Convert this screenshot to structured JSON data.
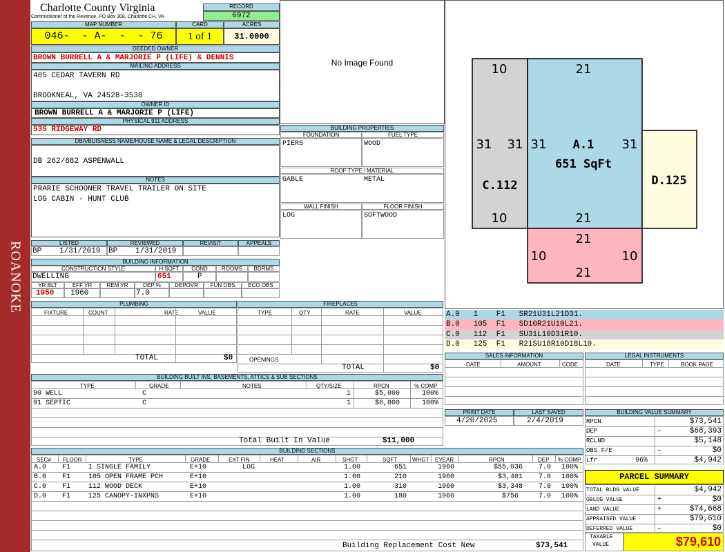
{
  "side_label": "ROANOKE",
  "header": {
    "county": "Charlotte County Virginia",
    "commissioner": "Commissioner of the Revenue, PO Box 308, Charlotte CH, VA",
    "record_label": "RECORD",
    "record": "6972",
    "map_number_label": "MAP NUMBER",
    "map_number": "046-  - A-  -  - 76",
    "card_label": "CARD",
    "card": "1 of 1",
    "acres_label": "ACRES",
    "acres": "31.0000"
  },
  "owner": {
    "deeded_owner_label": "DEEDED OWNER",
    "deeded_owner": "BROWN BURRELL A & MARJORIE P (LIFE) & DENNIS",
    "mailing_label": "MAILING ADDRESS",
    "mailing_line1": "405 CEDAR TAVERN RD",
    "mailing_line2": "BROOKNEAL, VA 24528-3538",
    "owner_id_label": "OWNER ID",
    "owner_id": "BROWN BURRELL A & MARJORIE P (LIFE)",
    "physical_label": "PHYSICAL 911 ADDRESS",
    "physical": "535 RIDGEWAY RD",
    "dba_label": "DBA/BUISNESS NAME/HOUSE NAME & LEGAL DESCRIPTION",
    "dba": "DB 262/682 ASPENWALL",
    "notes_label": "NOTES",
    "notes_line1": "PRARIE SCHOONER TRAVEL TRAILER ON SITE",
    "notes_line2": "LOG CABIN - HUNT CLUB"
  },
  "image_placeholder": "No Image Found",
  "building_properties": {
    "label": "BUILDING PROPERTIES",
    "foundation_label": "FOUNDATION",
    "foundation": "PIERS",
    "fuel_label": "FUEL TYPE",
    "fuel": "WOOD",
    "roof_label": "ROOF TYPE / MATERIAL",
    "roof_type": "GABLE",
    "roof_material": "METAL",
    "wall_label": "WALL FINISH",
    "wall": "LOG",
    "floor_label": "FLOOR FINISH",
    "floor": "SOFTWOOD"
  },
  "listing": {
    "listed_label": "LISTED",
    "listed_by": "BP",
    "listed_date": "1/31/2019",
    "reviewed_label": "REVIEWED",
    "reviewed_by": "BP",
    "reviewed_date": "1/31/2019",
    "revisit_label": "REVISIT",
    "appeals_label": "APPEALS"
  },
  "building_info": {
    "label": "BUILDING INFORMATION",
    "construction_label": "CONSTRUCTION STYLE",
    "construction": "DWELLING",
    "hsqft_label": "H SQFT",
    "hsqft": "651",
    "cond_label": "COND",
    "cond": "P",
    "rooms_label": "ROOMS",
    "bdrms_label": "BDRMS",
    "yrblt_label": "YR BLT",
    "yrblt": "1950",
    "effyr_label": "EFF YR",
    "effyr": "1960",
    "remyr_label": "REM YR",
    "dep_label": "DEP %",
    "dep": "7.0",
    "depovr_label": "DEPOVR",
    "funobs_label": "FUN OBS",
    "ecoobs_label": "ECO OBS"
  },
  "plumbing": {
    "label": "PLUMBING",
    "fixture_label": "FIXTURE",
    "count_label": "COUNT",
    "rate_label": "RATE",
    "value_label": "VALUE",
    "total_label": "TOTAL",
    "total": "$0"
  },
  "fireplaces": {
    "label": "FIREPLACES",
    "type_label": "TYPE",
    "qty_label": "QTY",
    "rate_label": "RATE",
    "value_label": "VALUE",
    "openings_label": "OPENINGS",
    "total_label": "TOTAL",
    "total": "$0"
  },
  "built_ins": {
    "label": "BUILDING BUILT INS, BASEMENTS, ATTICS & SUB SECTIONS",
    "cols": [
      "TYPE",
      "GRADE",
      "NOTES",
      "QTY/SIZE",
      "RPCN",
      "% COMP"
    ],
    "rows": [
      {
        "type": "90 WELL",
        "grade": "C",
        "qty": "1",
        "rpcn": "$5,000",
        "comp": "100%"
      },
      {
        "type": "91 SEPTIC",
        "grade": "C",
        "qty": "1",
        "rpcn": "$6,000",
        "comp": "100%"
      }
    ],
    "total_label": "Total Built In Value",
    "total": "$11,000"
  },
  "sections": {
    "label": "BUILDING SECTIONS",
    "cols": [
      "SEC#",
      "FLOOR",
      "TYPE",
      "GRADE",
      "EXT FIN",
      "HEAT",
      "AIR",
      "SHGT",
      "SQFT",
      "WHGT",
      "EYEAR",
      "RPCN",
      "DEP",
      "% COMP"
    ],
    "rows": [
      {
        "sec": "A.0",
        "floor": "F1",
        "type": "1 SINGLE FAMILY",
        "grade": "E+10",
        "ext": "LOG",
        "shgt": "1.00",
        "sqft": "651",
        "eyear": "1960",
        "rpcn": "$55,036",
        "dep": "7.0",
        "comp": "100%"
      },
      {
        "sec": "B.0",
        "floor": "F1",
        "type": "105 OPEN FRAME PCH",
        "grade": "E+10",
        "ext": "",
        "shgt": "1.00",
        "sqft": "210",
        "eyear": "1960",
        "rpcn": "$3,401",
        "dep": "7.0",
        "comp": "100%"
      },
      {
        "sec": "C.0",
        "floor": "F1",
        "type": "112 WOOD DECK",
        "grade": "E+10",
        "ext": "",
        "shgt": "1.00",
        "sqft": "310",
        "eyear": "1960",
        "rpcn": "$3,348",
        "dep": "7.0",
        "comp": "100%"
      },
      {
        "sec": "D.0",
        "floor": "F1",
        "type": "125 CANOPY-INXPNS",
        "grade": "E+10",
        "ext": "",
        "shgt": "1.00",
        "sqft": "180",
        "eyear": "1960",
        "rpcn": "$756",
        "dep": "7.0",
        "comp": "100%"
      }
    ],
    "total_label": "Building Replacement Cost New",
    "total": "$73,541"
  },
  "sketch": {
    "a_label": "A.1",
    "a_area": "651 SqFt",
    "a_top": "21",
    "a_bottom": "21",
    "a_left": "31",
    "a_right": "31",
    "c_label": "C.112",
    "c_top": "10",
    "c_bottom": "10",
    "c_left": "31",
    "c_right": "31",
    "d_label": "D.125",
    "b_top": "21",
    "b_bottom": "21",
    "b_left": "10",
    "b_right": "10",
    "legend": [
      {
        "text": "A.0   1    F1   SR21U31L21D31.",
        "color": "#add8e6"
      },
      {
        "text": "B.0   105  F1   SD10R21U10L21.",
        "color": "#ffb6c1"
      },
      {
        "text": "C.0   112  F1   SU31L10D31R10.",
        "color": "#d3d3d3"
      },
      {
        "text": "D.0   125  F1   R21SU18R10D18L10.",
        "color": "#fffde0"
      }
    ]
  },
  "sales": {
    "label": "SALES INFORMATION",
    "date_label": "DATE",
    "amount_label": "AMOUNT",
    "code_label": "CODE"
  },
  "legal": {
    "label": "LEGAL INSTRUMENTS",
    "date_label": "DATE",
    "type_label": "TYPE",
    "book_label": "BOOK PAGE"
  },
  "dates": {
    "print_label": "PRINT DATE",
    "print": "4/20/2025",
    "saved_label": "LAST SAVED",
    "saved": "2/4/2019"
  },
  "value_summary": {
    "label": "BUILDING VALUE SUMMARY",
    "rows": [
      {
        "label": "RPCN",
        "sign": "",
        "value": "$73,541"
      },
      {
        "label": "DEP",
        "sign": "–",
        "value": "$68,393"
      },
      {
        "label": "RCLND",
        "sign": "",
        "value": "$5,148"
      },
      {
        "label": "OBS F/E",
        "sign": "–",
        "value": "$0"
      },
      {
        "label": "Lfr",
        "sign": "96%",
        "value": "$4,942"
      }
    ]
  },
  "parcel": {
    "label": "PARCEL SUMMARY",
    "rows": [
      {
        "label": "TOTAL BLDG VALUE",
        "sign": "",
        "value": "$4,942"
      },
      {
        "label": "OBLDG VALUE",
        "sign": "+",
        "value": "$0"
      },
      {
        "label": "LAND VALUE",
        "sign": "+",
        "value": "$74,668"
      },
      {
        "label": "APPRAISED VALUE",
        "sign": "",
        "value": "$79,610"
      },
      {
        "label": "DEFERRED VALUE",
        "sign": "–",
        "value": "$0"
      }
    ],
    "taxable_label_1": "TAXABLE",
    "taxable_label_2": "VALUE",
    "taxable": "$79,610"
  }
}
